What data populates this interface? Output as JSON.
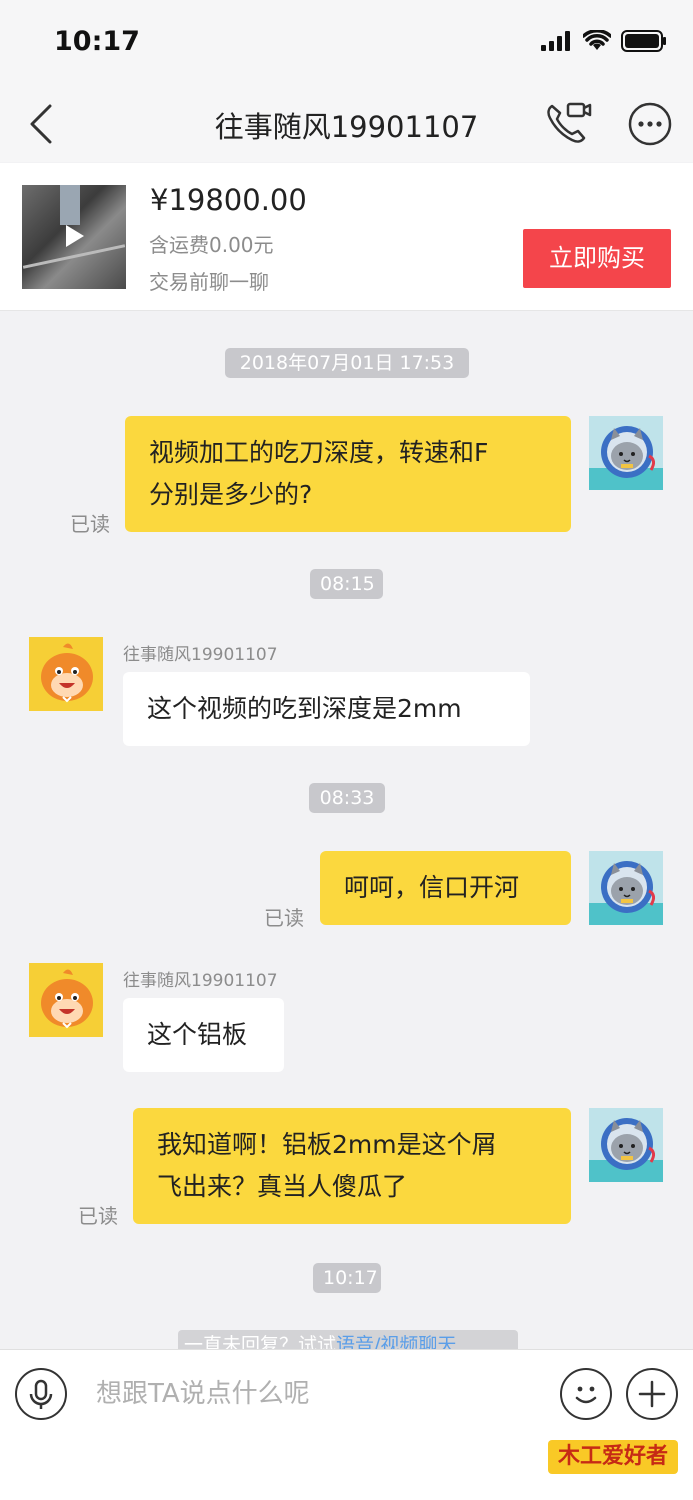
{
  "status_bar": {
    "time": "10:17"
  },
  "nav": {
    "title": "往事随风19901107"
  },
  "product": {
    "price": "¥19800.00",
    "shipping": "含运费0.00元",
    "hint": "交易前聊一聊",
    "buy_label": "立即购买"
  },
  "messages": {
    "ts1": "2018年07月01日 17:53",
    "m1": "视频加工的吃刀深度，转速和F\n分别是多少的?",
    "m1_read": "已读",
    "ts2": "08:15",
    "m2_sender": "往事随风19901107",
    "m2": "这个视频的吃到深度是2mm",
    "ts3": "08:33",
    "m3": "呵呵，信口开河",
    "m3_read": "已读",
    "m4_sender": "往事随风19901107",
    "m4": "这个铝板",
    "m5": "我知道啊！铝板2mm是这个屑\n飞出来？真当人傻瓜了",
    "m5_read": "已读",
    "ts4": "10:17"
  },
  "hint_strip": {
    "prefix": "一直未回复？试试",
    "link": "语音/视频聊天"
  },
  "input": {
    "placeholder": "想跟TA说点什么呢"
  },
  "watermark": {
    "text": "木工爱好者"
  },
  "colors": {
    "outgoing_bubble": "#fbd83e",
    "buy_button": "#f4454b",
    "background": "#f2f2f4"
  }
}
